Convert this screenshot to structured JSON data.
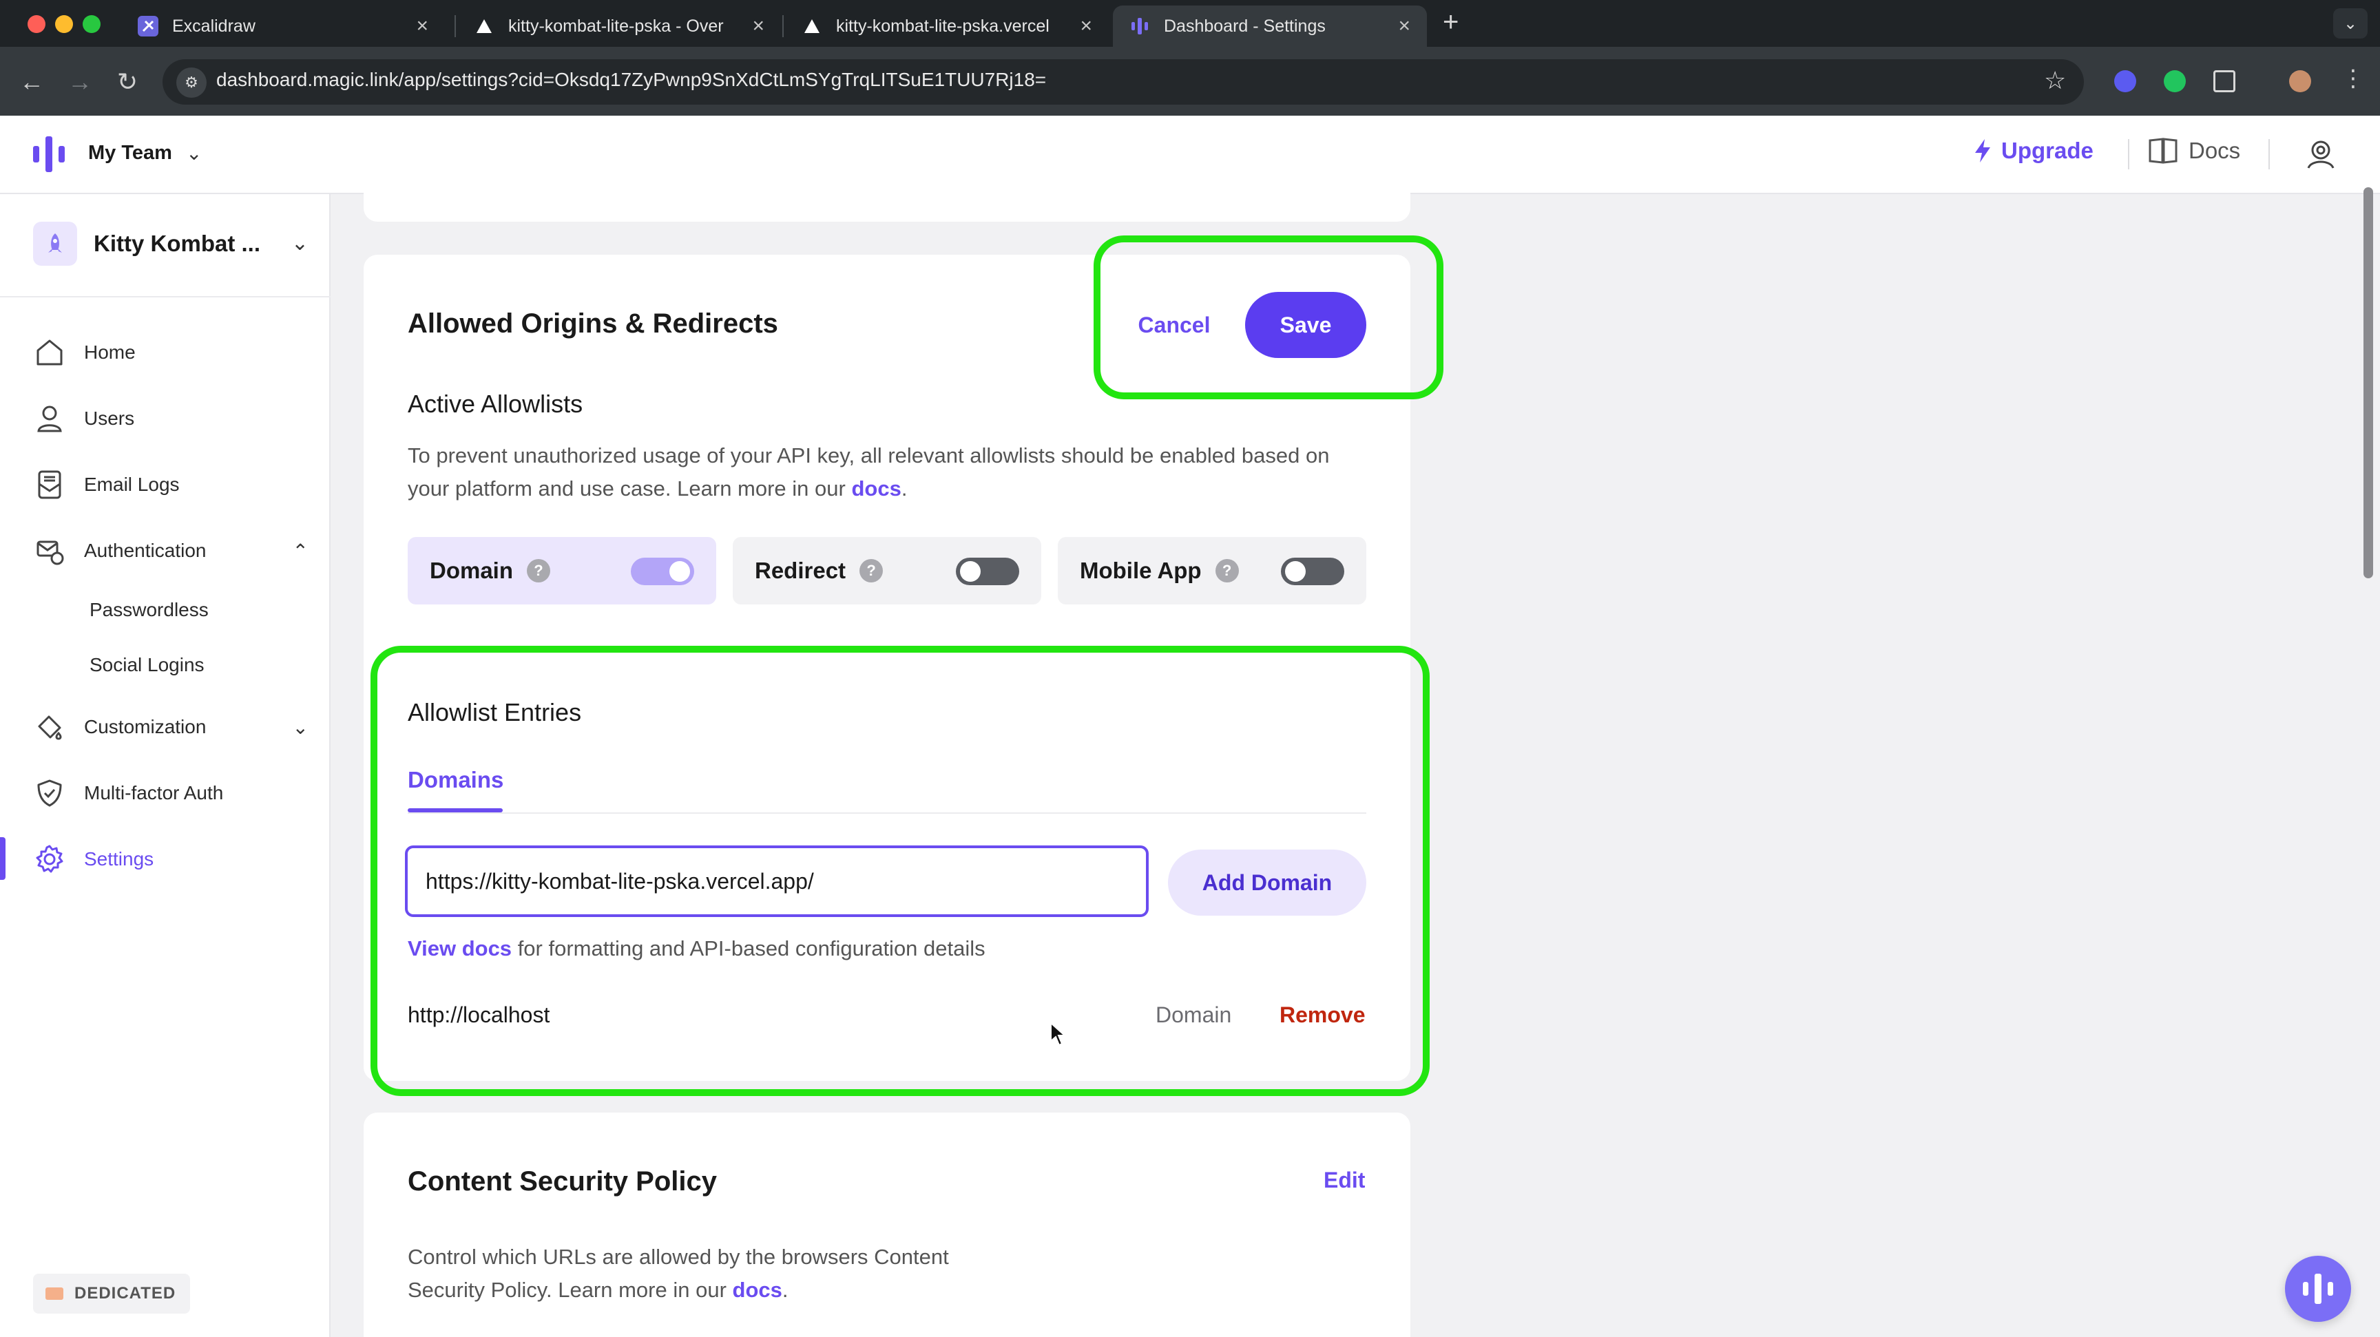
{
  "browser": {
    "tabs": [
      {
        "title": "Excalidraw"
      },
      {
        "title": "kitty-kombat-lite-pska - Over"
      },
      {
        "title": "kitty-kombat-lite-pska.vercel"
      },
      {
        "title": "Dashboard - Settings"
      }
    ],
    "new_tab": "+",
    "url": "dashboard.magic.link/app/settings?cid=Oksdq17ZyPwnp9SnXdCtLmSYgTrqLITSuE1TUU7Rj18="
  },
  "header": {
    "team": "My Team",
    "upgrade": "Upgrade",
    "docs": "Docs"
  },
  "sidebar": {
    "project": "Kitty Kombat ...",
    "items": [
      {
        "label": "Home",
        "icon": "home-icon"
      },
      {
        "label": "Users",
        "icon": "user-icon"
      },
      {
        "label": "Email Logs",
        "icon": "email-log-icon"
      },
      {
        "label": "Authentication",
        "icon": "auth-icon"
      },
      {
        "label": "Customization",
        "icon": "paint-icon"
      },
      {
        "label": "Multi-factor Auth",
        "icon": "shield-check-icon"
      },
      {
        "label": "Settings",
        "icon": "gear-icon"
      }
    ],
    "subitems": [
      "Passwordless",
      "Social Logins"
    ],
    "plan": "DEDICATED",
    "active": "Settings"
  },
  "allowlist": {
    "title": "Allowed Origins & Redirects",
    "cancel": "Cancel",
    "save": "Save",
    "active_title": "Active Allowlists",
    "description": "To prevent unauthorized usage of your API key, all relevant allowlists should be enabled based on your platform and use case. Learn more in our",
    "docs_link": "docs",
    "toggles": [
      {
        "label": "Domain",
        "on": true
      },
      {
        "label": "Redirect",
        "on": false
      },
      {
        "label": "Mobile App",
        "on": false
      }
    ],
    "entries_title": "Allowlist Entries",
    "tab": "Domains",
    "input_value": "https://kitty-kombat-lite-pska.vercel.app/",
    "add_button": "Add Domain",
    "view_docs": "View docs",
    "view_docs_suffix": "for formatting and API-based configuration details",
    "entries": [
      {
        "value": "http://localhost",
        "type": "Domain",
        "action": "Remove"
      }
    ]
  },
  "csp": {
    "title": "Content Security Policy",
    "edit": "Edit",
    "description_line1": "Control which URLs are allowed by the browsers Content",
    "description_line2": "Security Policy. Learn more in our",
    "docs_link": "docs"
  },
  "colors": {
    "accent": "#6a4cf0",
    "save": "#5b3df0",
    "remove": "#c0260e",
    "highlight": "#22e510"
  }
}
